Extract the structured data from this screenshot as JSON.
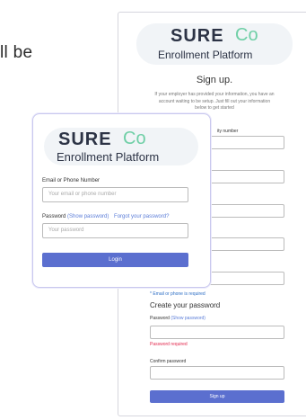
{
  "background": {
    "partial_text": "ll be"
  },
  "brand": {
    "word": "SURE",
    "co": "Co",
    "subtitle": "Enrollment Platform"
  },
  "signup": {
    "title": "Sign up.",
    "description": "If your employer has provided your information, you have an account waiting to be setup. Just fill out your information below to get started",
    "fields": [
      {
        "label": "ity number",
        "error": ""
      },
      {
        "label": "",
        "error": ""
      },
      {
        "label": "",
        "error": ""
      },
      {
        "label": "",
        "error": ""
      },
      {
        "label": "",
        "error": ""
      }
    ],
    "email_phone_note": "* Email or phone is required",
    "create_password_heading": "Create your password",
    "password_label": "Password",
    "show_password": "(Show password)",
    "password_error": "Password required",
    "confirm_label": "Confirm password",
    "submit_label": "Sign up"
  },
  "login": {
    "email_label": "Email or Phone Number",
    "email_placeholder": "Your email or phone number",
    "password_label": "Password",
    "show_password": "(Show password)",
    "forgot_password": "Forgot your password?",
    "password_placeholder": "Your password",
    "submit_label": "Login"
  },
  "colors": {
    "primary_button": "#5b6fcf",
    "brand_accent": "#6fcfa6",
    "error": "#e2284d",
    "link": "#5b7dd8"
  }
}
